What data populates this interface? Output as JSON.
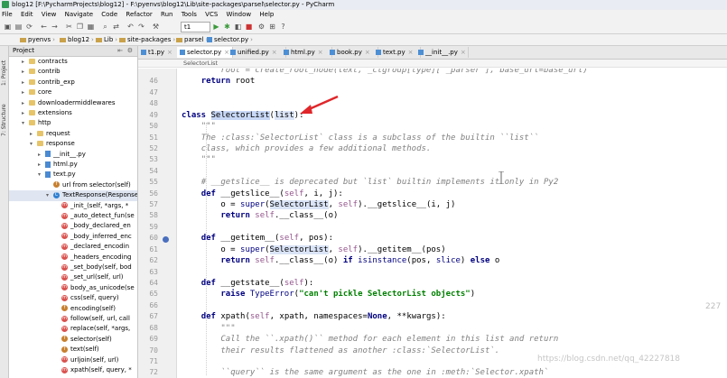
{
  "window": {
    "title": "blog12 [F:\\PycharmProjects\\blog12] - F:\\pyenvs\\blog12\\Lib\\site-packages\\parsel\\selector.py - PyCharm"
  },
  "menu": [
    "File",
    "Edit",
    "View",
    "Navigate",
    "Code",
    "Refactor",
    "Run",
    "Tools",
    "VCS",
    "Window",
    "Help"
  ],
  "toolbar": {
    "run_config": "t1"
  },
  "breadcrumb": [
    "pyenvs",
    "blog12",
    "Lib",
    "site-packages",
    "parsel",
    "selector.py"
  ],
  "sidebar": {
    "panel_title": "Project",
    "vertical_labels": [
      "1: Project",
      "7: Structure"
    ],
    "tree": [
      {
        "label": "contracts",
        "icon": "folder",
        "depth": 3,
        "arrow": ">"
      },
      {
        "label": "contrib",
        "icon": "folder",
        "depth": 3,
        "arrow": ">"
      },
      {
        "label": "contrib_exp",
        "icon": "folder",
        "depth": 3,
        "arrow": ">"
      },
      {
        "label": "core",
        "icon": "folder",
        "depth": 3,
        "arrow": ">"
      },
      {
        "label": "downloadermiddlewares",
        "icon": "folder",
        "depth": 3,
        "arrow": ">"
      },
      {
        "label": "extensions",
        "icon": "folder",
        "depth": 3,
        "arrow": ">"
      },
      {
        "label": "http",
        "icon": "folder",
        "depth": 3,
        "arrow": "v"
      },
      {
        "label": "request",
        "icon": "folder",
        "depth": 4,
        "arrow": ">"
      },
      {
        "label": "response",
        "icon": "folder",
        "depth": 4,
        "arrow": "v"
      },
      {
        "label": "__init__.py",
        "icon": "py",
        "depth": 5,
        "arrow": ">"
      },
      {
        "label": "html.py",
        "icon": "py",
        "depth": 5,
        "arrow": ">"
      },
      {
        "label": "text.py",
        "icon": "py",
        "depth": 5,
        "arrow": "v"
      },
      {
        "label": "url from selector(self)",
        "icon": "f",
        "depth": 6,
        "arrow": ""
      },
      {
        "label": "TextResponse(Response)",
        "icon": "class",
        "depth": 6,
        "arrow": "v",
        "selected": true
      },
      {
        "label": "_init_(self, *args, *",
        "icon": "m",
        "depth": 7,
        "arrow": ""
      },
      {
        "label": "_auto_detect_fun(se",
        "icon": "m",
        "depth": 7,
        "arrow": ""
      },
      {
        "label": "_body_declared_en",
        "icon": "m",
        "depth": 7,
        "arrow": ""
      },
      {
        "label": "_body_inferred_enc",
        "icon": "m",
        "depth": 7,
        "arrow": ""
      },
      {
        "label": "_declared_encodin",
        "icon": "m",
        "depth": 7,
        "arrow": ""
      },
      {
        "label": "_headers_encoding",
        "icon": "m",
        "depth": 7,
        "arrow": ""
      },
      {
        "label": "_set_body(self, bod",
        "icon": "m",
        "depth": 7,
        "arrow": ""
      },
      {
        "label": "_set_url(self, url)",
        "icon": "m",
        "depth": 7,
        "arrow": ""
      },
      {
        "label": "body_as_unicode(se",
        "icon": "m",
        "depth": 7,
        "arrow": ""
      },
      {
        "label": "css(self, query)",
        "icon": "m",
        "depth": 7,
        "arrow": ""
      },
      {
        "label": "encoding(self)",
        "icon": "f",
        "depth": 7,
        "arrow": ""
      },
      {
        "label": "follow(self, url, call",
        "icon": "m",
        "depth": 7,
        "arrow": ""
      },
      {
        "label": "replace(self, *args,",
        "icon": "m",
        "depth": 7,
        "arrow": ""
      },
      {
        "label": "selector(self)",
        "icon": "f",
        "depth": 7,
        "arrow": ""
      },
      {
        "label": "text(self)",
        "icon": "f",
        "depth": 7,
        "arrow": ""
      },
      {
        "label": "urljoin(self, url)",
        "icon": "m",
        "depth": 7,
        "arrow": ""
      },
      {
        "label": "xpath(self, query, *",
        "icon": "m",
        "depth": 7,
        "arrow": ""
      }
    ]
  },
  "tabs": [
    {
      "label": "t1.py"
    },
    {
      "label": "selector.py",
      "active": true
    },
    {
      "label": "unified.py"
    },
    {
      "label": "html.py"
    },
    {
      "label": "book.py"
    },
    {
      "label": "text.py"
    },
    {
      "label": "__init__.py"
    }
  ],
  "editor": {
    "structure_crumb": "SelectorList",
    "lines": [
      {
        "n": "",
        "html": "        <span class=\"doc\">root = create_root_node(text, _ctgroup[type]['_parser'], base_url=base_url)</span>"
      },
      {
        "n": "46",
        "html": "    <span class=\"kw\">return</span> root"
      },
      {
        "n": "47",
        "html": ""
      },
      {
        "n": "48",
        "html": ""
      },
      {
        "n": "49",
        "html": "<span class=\"kw\">class</span> <span class=\"hl\">SelectorList</span>(<span class=\"hl2\">list</span>):"
      },
      {
        "n": "50",
        "html": "    <span class=\"doc\">\"\"\"</span>"
      },
      {
        "n": "51",
        "html": "    <span class=\"doc\">The :class:`SelectorList` class is a subclass of the builtin ``list``</span>"
      },
      {
        "n": "52",
        "html": "    <span class=\"doc\">class, which provides a few additional methods.</span>"
      },
      {
        "n": "53",
        "html": "    <span class=\"doc\">\"\"\"</span>"
      },
      {
        "n": "54",
        "html": ""
      },
      {
        "n": "55",
        "html": "    <span class=\"cm\"># __getslice__ is deprecated but `list` builtin implements it only in Py2</span>"
      },
      {
        "n": "56",
        "html": "    <span class=\"kw\">def</span> __getslice__(<span class=\"slf\">self</span>, i, j):"
      },
      {
        "n": "57",
        "html": "        o = <span class=\"bi\">super</span>(<span class=\"hl2\">SelectorList</span>, <span class=\"slf\">self</span>).__getslice__(i, j)"
      },
      {
        "n": "58",
        "html": "        <span class=\"kw\">return</span> <span class=\"slf\">self</span>.__class__(o)"
      },
      {
        "n": "59",
        "html": ""
      },
      {
        "n": "60",
        "html": "    <span class=\"kw\">def</span> __getitem__(<span class=\"slf\">self</span>, pos):"
      },
      {
        "n": "61",
        "html": "        o = <span class=\"bi\">super</span>(<span class=\"hl2\">SelectorList</span>, <span class=\"slf\">self</span>).__getitem__(pos)"
      },
      {
        "n": "62",
        "html": "        <span class=\"kw\">return</span> <span class=\"slf\">self</span>.__class__(o) <span class=\"kw\">if</span> <span class=\"bi\">isinstance</span>(pos, <span class=\"bi\">slice</span>) <span class=\"kw\">else</span> o"
      },
      {
        "n": "63",
        "html": ""
      },
      {
        "n": "64",
        "html": "    <span class=\"kw\">def</span> __getstate__(<span class=\"slf\">self</span>):"
      },
      {
        "n": "65",
        "html": "        <span class=\"kw\">raise</span> <span class=\"bi\">TypeError</span>(<span class=\"str\">\"can't pickle SelectorList objects\"</span>)"
      },
      {
        "n": "66",
        "html": ""
      },
      {
        "n": "67",
        "html": "    <span class=\"kw\">def</span> xpath(<span class=\"slf\">self</span>, xpath, namespaces=<span class=\"kw\">None</span>, **kwargs):"
      },
      {
        "n": "68",
        "html": "        <span class=\"doc\">\"\"\"</span>"
      },
      {
        "n": "69",
        "html": "        <span class=\"doc\">Call the ``.xpath()`` method for each element in this list and return</span>"
      },
      {
        "n": "70",
        "html": "        <span class=\"doc\">their results flattened as another :class:`SelectorList`.</span>"
      },
      {
        "n": "71",
        "html": ""
      },
      {
        "n": "72",
        "html": "        <span class=\"doc\">``query`` is the same argument as the one in :meth:`Selector.xpath`</span>"
      }
    ]
  },
  "watermark": "https://blog.csdn.net/qq_42227818",
  "right_edge_number": "227",
  "colors": {
    "keyword": "#000080",
    "docstring": "#808080",
    "string": "#008000",
    "self": "#94558d",
    "annotation_arrow": "#e0262a"
  }
}
